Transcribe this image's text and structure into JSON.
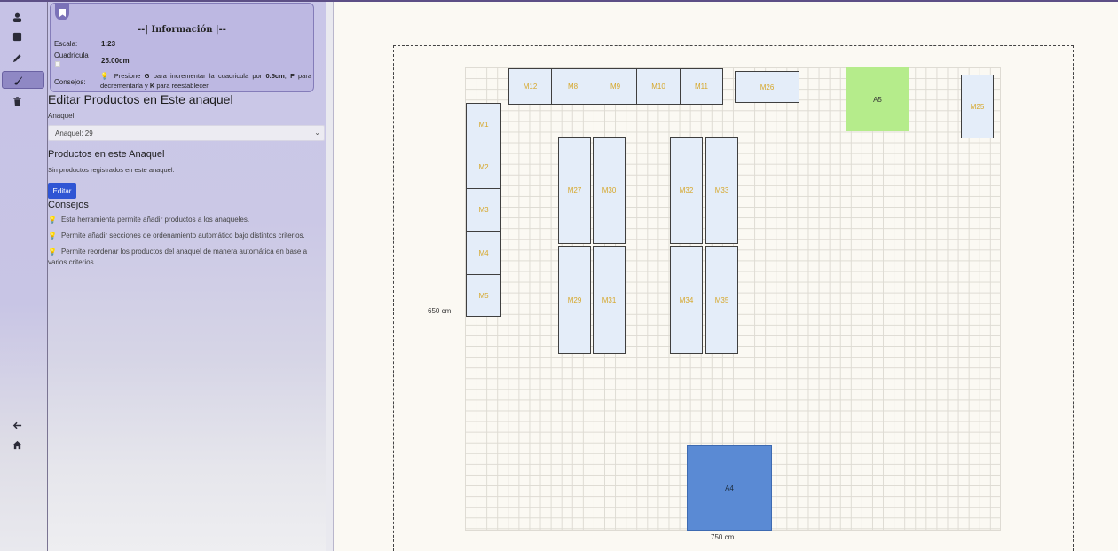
{
  "rail": {
    "items": [
      {
        "icon": "user-icon",
        "active": false
      },
      {
        "icon": "square-icon",
        "active": false
      },
      {
        "icon": "pencil-icon",
        "active": false
      },
      {
        "icon": "brush-icon",
        "active": true
      },
      {
        "icon": "trash-icon",
        "active": false
      },
      {
        "icon": "back-arrow-icon",
        "active": false
      },
      {
        "icon": "home-icon",
        "active": false
      }
    ]
  },
  "info": {
    "title": "--| Información |--",
    "scale_label": "Escala:",
    "scale_value": "1:23",
    "grid_label": "Cuadrícula",
    "grid_value": "25.00cm",
    "tips_label": "Consejos:",
    "tips_prefix": "Presione ",
    "key_g": "G",
    "tips_mid1": " para incrementar la cuadricula por ",
    "step": "0.5cm",
    "tips_mid2": ", ",
    "key_f": "F",
    "tips_mid3": " para decrementarla y ",
    "key_k": "K",
    "tips_suffix": " para reestablecer."
  },
  "editor": {
    "heading": "Editar Productos en Este anaquel",
    "shelf_label": "Anaquel:",
    "shelf_selected": "Anaquel: 29",
    "products_heading": "Productos en este Anaquel",
    "no_products": "Sin productos registrados en este anaquel.",
    "edit_button": "Editar",
    "tips_heading": "Consejos",
    "tips": [
      "Esta herramienta permite añadir productos a los anaqueles.",
      "Permite añadir secciones de ordenamiento automático bajo distintos criterios.",
      "Permite reordenar los productos del anaquel de manera automática en base a varios criterios."
    ]
  },
  "canvas": {
    "height_label": "650 cm",
    "width_label": "750 cm",
    "shelves": {
      "m12": "M12",
      "m8": "M8",
      "m9": "M9",
      "m10": "M10",
      "m11": "M11",
      "m26": "M26",
      "m25": "M25",
      "m1": "M1",
      "m2": "M2",
      "m3": "M3",
      "m4": "M4",
      "m5": "M5",
      "m27": "M27",
      "m30": "M30",
      "m32": "M32",
      "m33": "M33",
      "m29": "M29",
      "m31": "M31",
      "m34": "M34",
      "m35": "M35"
    },
    "zones": {
      "a5": "A5",
      "a4": "A4"
    },
    "colors": {
      "shelf": "#e4edf9",
      "shelf_text": "#d6a72a",
      "zone_a5": "#b5ec8b",
      "zone_a4": "#5a8ad4",
      "accent": "#2f55d4"
    }
  }
}
